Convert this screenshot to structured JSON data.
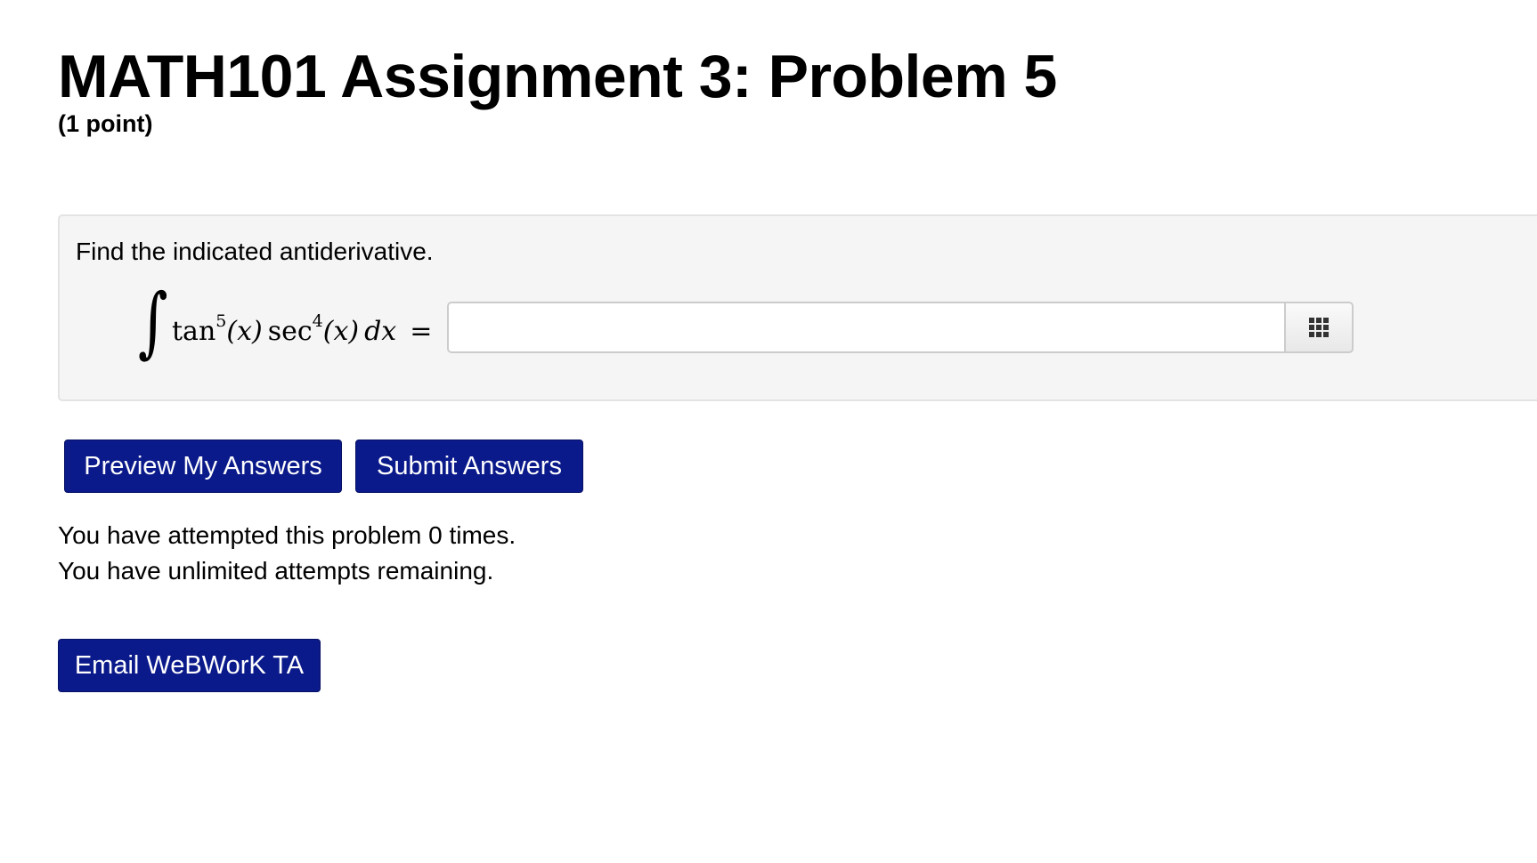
{
  "page": {
    "title": "MATH101 Assignment 3: Problem 5",
    "points": "(1 point)"
  },
  "problem": {
    "instruction": "Find the indicated antiderivative.",
    "math": {
      "integral_symbol": "∫",
      "func1": "tan",
      "exp1": "5",
      "arg1": "(x)",
      "func2": "sec",
      "exp2": "4",
      "arg2": "(x)",
      "differential": "dx",
      "equals": "="
    },
    "answer": {
      "value": "",
      "placeholder": ""
    },
    "palette_icon": "grid-icon"
  },
  "buttons": {
    "preview_label": "Preview My Answers",
    "submit_label": "Submit Answers",
    "email_label": "Email WeBWorK TA"
  },
  "attempts": {
    "line1": "You have attempted this problem 0 times.",
    "line2": "You have unlimited attempts remaining."
  },
  "colors": {
    "button_bg": "#0b1a8a",
    "panel_bg": "#f5f5f5"
  }
}
